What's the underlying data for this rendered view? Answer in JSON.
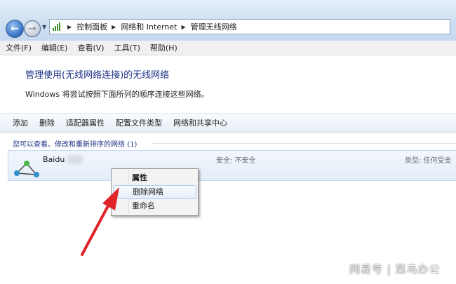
{
  "nav": {
    "back_icon": "back-arrow-icon",
    "forward_icon": "forward-arrow-icon"
  },
  "breadcrumb": [
    "控制面板",
    "网络和 Internet",
    "管理无线网络"
  ],
  "menu": [
    "文件(F)",
    "编辑(E)",
    "查看(V)",
    "工具(T)",
    "帮助(H)"
  ],
  "header": {
    "title": "管理使用(无线网络连接)的无线网络",
    "description": "Windows 将尝试按照下面所列的顺序连接这些网络。"
  },
  "toolbar": [
    "添加",
    "删除",
    "适配器属性",
    "配置文件类型",
    "网络和共享中心"
  ],
  "section": {
    "heading": "您可以查看、修改和重新排序的网络 (1)"
  },
  "network": {
    "name": "Baidu",
    "security": "安全: 不安全",
    "type": "类型: 任何受支"
  },
  "context_menu": [
    "属性",
    "删除网络",
    "重命名"
  ],
  "watermark": "网易号 | 菜鸟办公",
  "colors": {
    "title_blue": "#1e3287",
    "arrow_red": "#e0242a",
    "menu_highlight": "#aecbee"
  }
}
